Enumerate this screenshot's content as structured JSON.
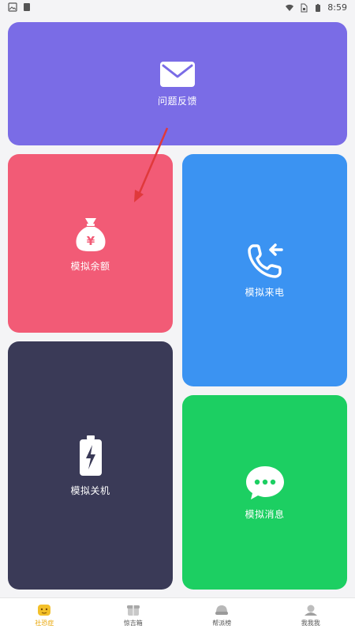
{
  "status_bar": {
    "time": "8:59"
  },
  "colors": {
    "feedback": "#7a6ce6",
    "balance": "#f25b76",
    "call": "#3b93f2",
    "shutdown": "#3a3a57",
    "message": "#1ccf62",
    "tab_active": "#f3c02a"
  },
  "cards": {
    "feedback": {
      "label": "问题反馈",
      "icon": "envelope-icon"
    },
    "balance": {
      "label": "模拟余额",
      "icon": "money-bag-icon"
    },
    "call": {
      "label": "模拟来电",
      "icon": "incoming-call-icon"
    },
    "shutdown": {
      "label": "模拟关机",
      "icon": "battery-icon"
    },
    "message": {
      "label": "模拟消息",
      "icon": "chat-bubble-icon"
    }
  },
  "tabs": [
    {
      "label": "社恐症",
      "active": true
    },
    {
      "label": "惊吉箱",
      "active": false
    },
    {
      "label": "帮派榜",
      "active": false
    },
    {
      "label": "我我我",
      "active": false
    }
  ]
}
